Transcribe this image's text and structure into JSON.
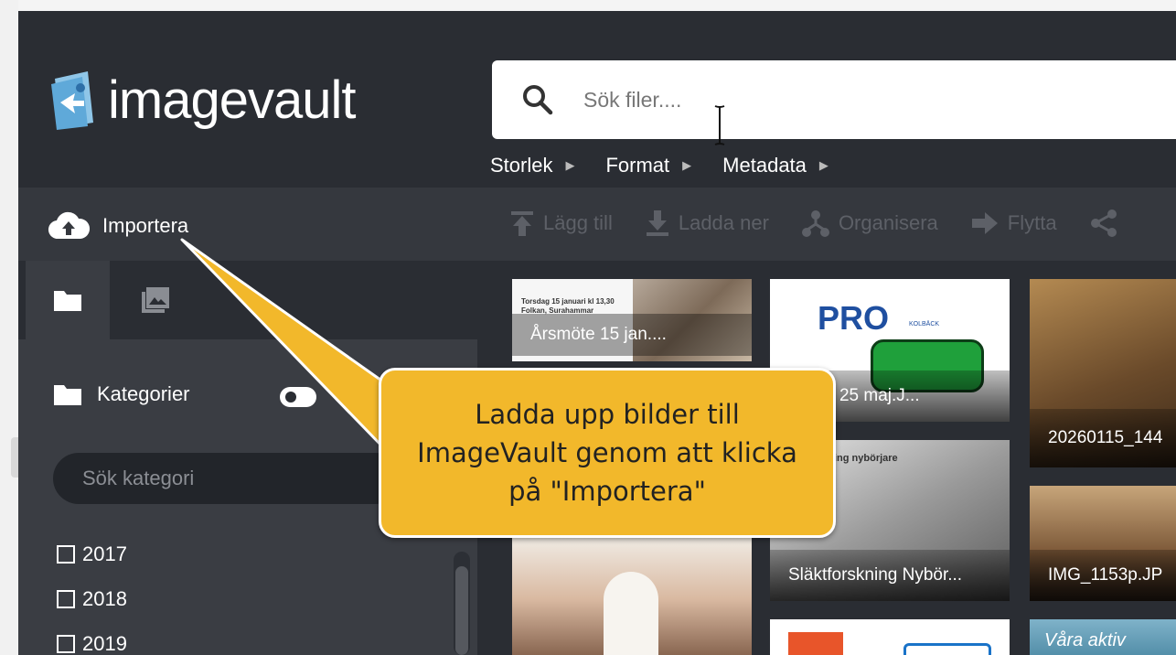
{
  "app": {
    "brand": "imagevault"
  },
  "search": {
    "placeholder": "Sök filer...."
  },
  "filters": [
    {
      "label": "Storlek"
    },
    {
      "label": "Format"
    },
    {
      "label": "Metadata"
    }
  ],
  "toolbar": {
    "import_label": "Importera",
    "actions": [
      {
        "label": "Lägg till",
        "icon": "upload-arrow-icon"
      },
      {
        "label": "Ladda ner",
        "icon": "download-icon"
      },
      {
        "label": "Organisera",
        "icon": "organize-icon"
      },
      {
        "label": "Flytta",
        "icon": "arrow-right-icon"
      }
    ]
  },
  "sidebar": {
    "tabs": [
      {
        "icon": "folder-icon"
      },
      {
        "icon": "images-icon"
      }
    ],
    "category_header": "Kategorier",
    "category_search_placeholder": "Sök kategori",
    "years": [
      "2017",
      "2018",
      "2019"
    ]
  },
  "grid": {
    "items": [
      {
        "label": "Årsmöte 15 jan...."
      },
      {
        "label": "o slott 25 maj.J..."
      },
      {
        "label": "20260115_144"
      },
      {
        "label": "Släktforskning Nybör..."
      },
      {
        "label": "IMG_1153p.JP"
      }
    ],
    "thumb_text": {
      "poster1": "Torsdag 15 januari kl 13,30 Folkan, Surahammar",
      "pro_logo": "PRO",
      "pro_sub": "KOLBÄCK",
      "slakt_title": "ing nybörjare",
      "partial_bottom": "Våra aktiv"
    }
  },
  "callout": {
    "text": "Ladda upp bilder till ImageVault genom att klicka på \"Importera\""
  },
  "colors": {
    "callout": "#f2b82b",
    "header_bg": "#2a2d33",
    "sidebar_bg": "#3a3d43"
  }
}
